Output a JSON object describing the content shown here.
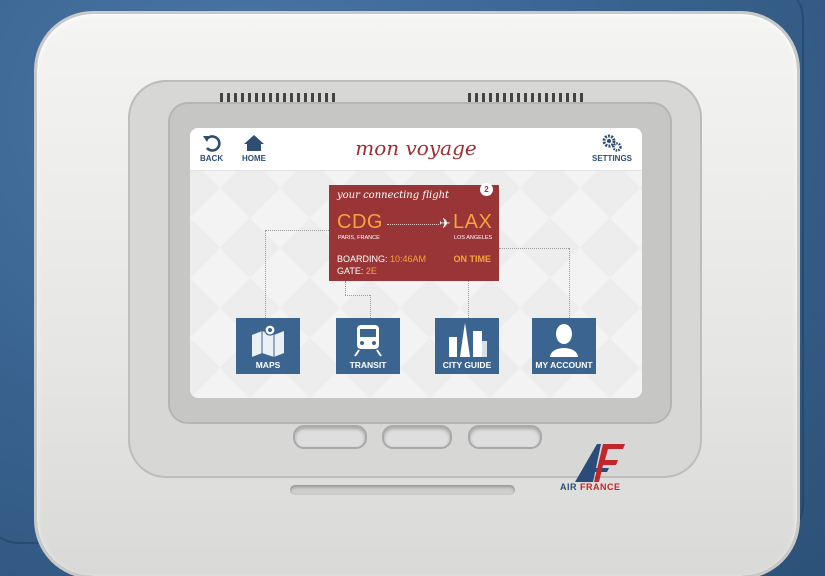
{
  "screen": {
    "title": "mon voyage",
    "back_label": "BACK",
    "home_label": "HOME",
    "settings_label": "SETTINGS"
  },
  "flight": {
    "header": "your connecting flight",
    "badge": "2",
    "origin_code": "CDG",
    "origin_city": "PARIS, FRANCE",
    "dest_code": "LAX",
    "dest_city": "LOS ANGELES",
    "boarding_label": "BOARDING:",
    "boarding_time": "10:46AM",
    "gate_label": "GATE:",
    "gate": "2E",
    "status": "ON TIME"
  },
  "tiles": [
    {
      "label": "MAPS",
      "icon": "map-icon"
    },
    {
      "label": "TRANSIT",
      "icon": "train-icon"
    },
    {
      "label": "CITY GUIDE",
      "icon": "city-skyline-icon"
    },
    {
      "label": "MY ACCOUNT",
      "icon": "user-icon"
    }
  ],
  "brand": {
    "air": "AIR",
    "france": "FRANCE"
  },
  "colors": {
    "accent_red": "#9a3537",
    "tile_blue": "#3b6590",
    "highlight_orange": "#f2a53a",
    "seat_blue": "#3a6491"
  }
}
